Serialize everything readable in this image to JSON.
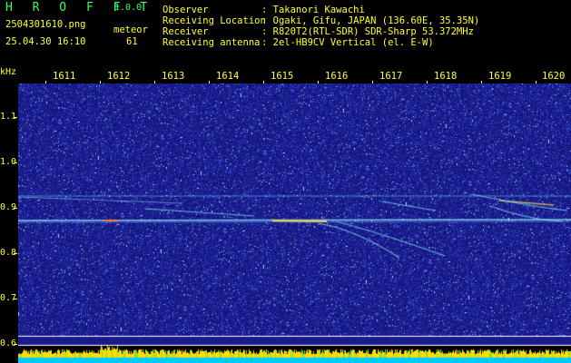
{
  "app": {
    "title": "H R O F F T",
    "version": "1.0.0"
  },
  "file": {
    "name": "2504301610.png",
    "datetime": "25.04.30 16:10"
  },
  "meteor": {
    "label": "meteor",
    "count": "61"
  },
  "info": [
    {
      "label": "Observer",
      "value": ": Takanori Kawachi"
    },
    {
      "label": "Receiving Location",
      "value": ": Ogaki, Gifu, JAPAN (136.60E, 35.35N)"
    },
    {
      "label": "Receiver",
      "value": ": R820T2(RTL-SDR) SDR-Sharp 53.372MHz"
    },
    {
      "label": "Receiving antenna",
      "value": ": 2el-HB9CV Vertical (el. E-W)"
    }
  ],
  "y_axis": {
    "unit": "kHz",
    "ticks": [
      "1.1",
      "1.0",
      "0.9",
      "0.8",
      "0.7",
      "0.6"
    ]
  },
  "x_axis": {
    "ticks": [
      "1611",
      "1612",
      "1613",
      "1614",
      "1615",
      "1616",
      "1617",
      "1618",
      "1619",
      "1620"
    ]
  },
  "colors": {
    "background": "#1a1a8c",
    "label_text": "#ffff33",
    "title_text": "#33ff66",
    "baseline": "#ffffff",
    "level_bar": "#ffdd00",
    "level_base": "#00ccff"
  }
}
